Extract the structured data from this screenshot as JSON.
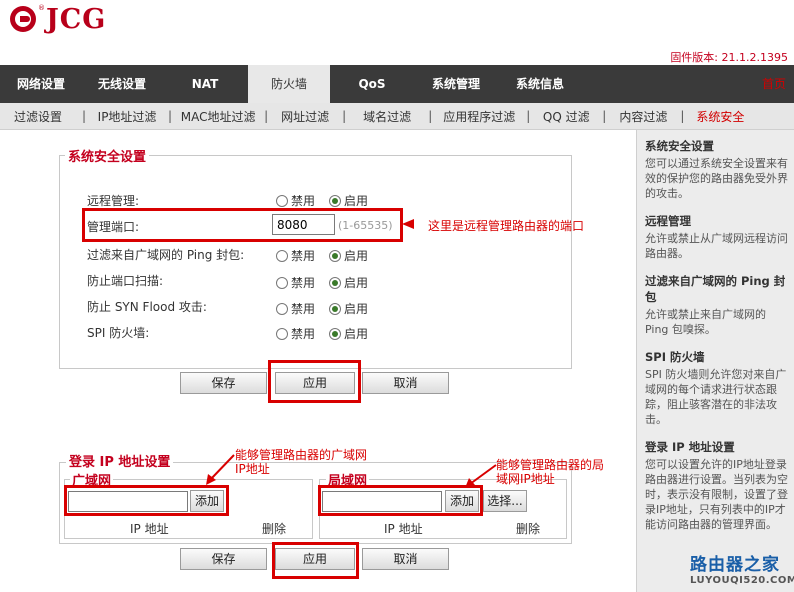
{
  "brand": {
    "name": "JCG",
    "reg": "®"
  },
  "firmware": "固件版本: 21.1.2.1395",
  "mainnav": {
    "items": [
      {
        "label": "网络设置",
        "active": false
      },
      {
        "label": "无线设置",
        "active": false
      },
      {
        "label": "NAT",
        "active": false
      },
      {
        "label": "防火墙",
        "active": true
      },
      {
        "label": "QoS",
        "active": false
      },
      {
        "label": "系统管理",
        "active": false
      },
      {
        "label": "系统信息",
        "active": false
      }
    ],
    "home": "首页"
  },
  "subnav": {
    "items": [
      {
        "label": "过滤设置",
        "active": false
      },
      {
        "label": "IP地址过滤",
        "active": false
      },
      {
        "label": "MAC地址过滤",
        "active": false
      },
      {
        "label": "网址过滤",
        "active": false
      },
      {
        "label": "域名过滤",
        "active": false
      },
      {
        "label": "应用程序过滤",
        "active": false
      },
      {
        "label": "QQ 过滤",
        "active": false
      },
      {
        "label": "内容过滤",
        "active": false
      },
      {
        "label": "系统安全",
        "active": true
      }
    ]
  },
  "security": {
    "legend": "系统安全设置",
    "rows": [
      {
        "label": "远程管理:",
        "option_off": "禁用",
        "option_on": "启用",
        "selected": "on"
      },
      {
        "label": "管理端口:",
        "port_value": "8080",
        "port_range": "(1-65535)"
      },
      {
        "label": "过滤来自广域网的 Ping 封包:",
        "option_off": "禁用",
        "option_on": "启用",
        "selected": "on"
      },
      {
        "label": "防止端口扫描:",
        "option_off": "禁用",
        "option_on": "启用",
        "selected": "on"
      },
      {
        "label": "防止 SYN Flood 攻击:",
        "option_off": "禁用",
        "option_on": "启用",
        "selected": "on"
      },
      {
        "label": "SPI 防火墙:",
        "option_off": "禁用",
        "option_on": "启用",
        "selected": "on"
      }
    ]
  },
  "buttons": {
    "save": "保存",
    "apply": "应用",
    "cancel": "取消",
    "add": "添加",
    "choose": "选择..."
  },
  "login_ip": {
    "legend": "登录 IP 地址设置",
    "wan": {
      "legend": "广域网",
      "col_ip": "IP 地址",
      "col_delete": "删除"
    },
    "lan": {
      "legend": "局域网",
      "col_ip": "IP 地址",
      "col_delete": "删除"
    }
  },
  "annotations": {
    "port": "这里是远程管理路由器的端口",
    "wan_line1": "能够管理路由器的广域网",
    "wan_line2": "IP地址",
    "lan_line1": "能够管理路由器的局",
    "lan_line2": "域网IP地址"
  },
  "help": [
    {
      "title": "系统安全设置",
      "text": "您可以通过系统安全设置来有效的保护您的路由器免受外界的攻击。"
    },
    {
      "title": "远程管理",
      "text": "允许或禁止从广域网远程访问路由器。"
    },
    {
      "title": "过滤来自广域网的 Ping 封包",
      "text": "允许或禁止来自广域网的 Ping 包嗅探。"
    },
    {
      "title": "SPI 防火墙",
      "text": "SPI 防火墙则允许您对来自广域网的每个请求进行状态跟踪，阻止骇客潜在的非法攻击。"
    },
    {
      "title": "登录 IP 地址设置",
      "text": "您可以设置允许的IP地址登录路由器进行设置。当列表为空时，表示没有限制，设置了登录IP地址，只有列表中的IP才能访问路由器的管理界面。"
    }
  ],
  "watermark": {
    "line1": "路由器之家",
    "line2": "LUYOUQI520.COM"
  }
}
